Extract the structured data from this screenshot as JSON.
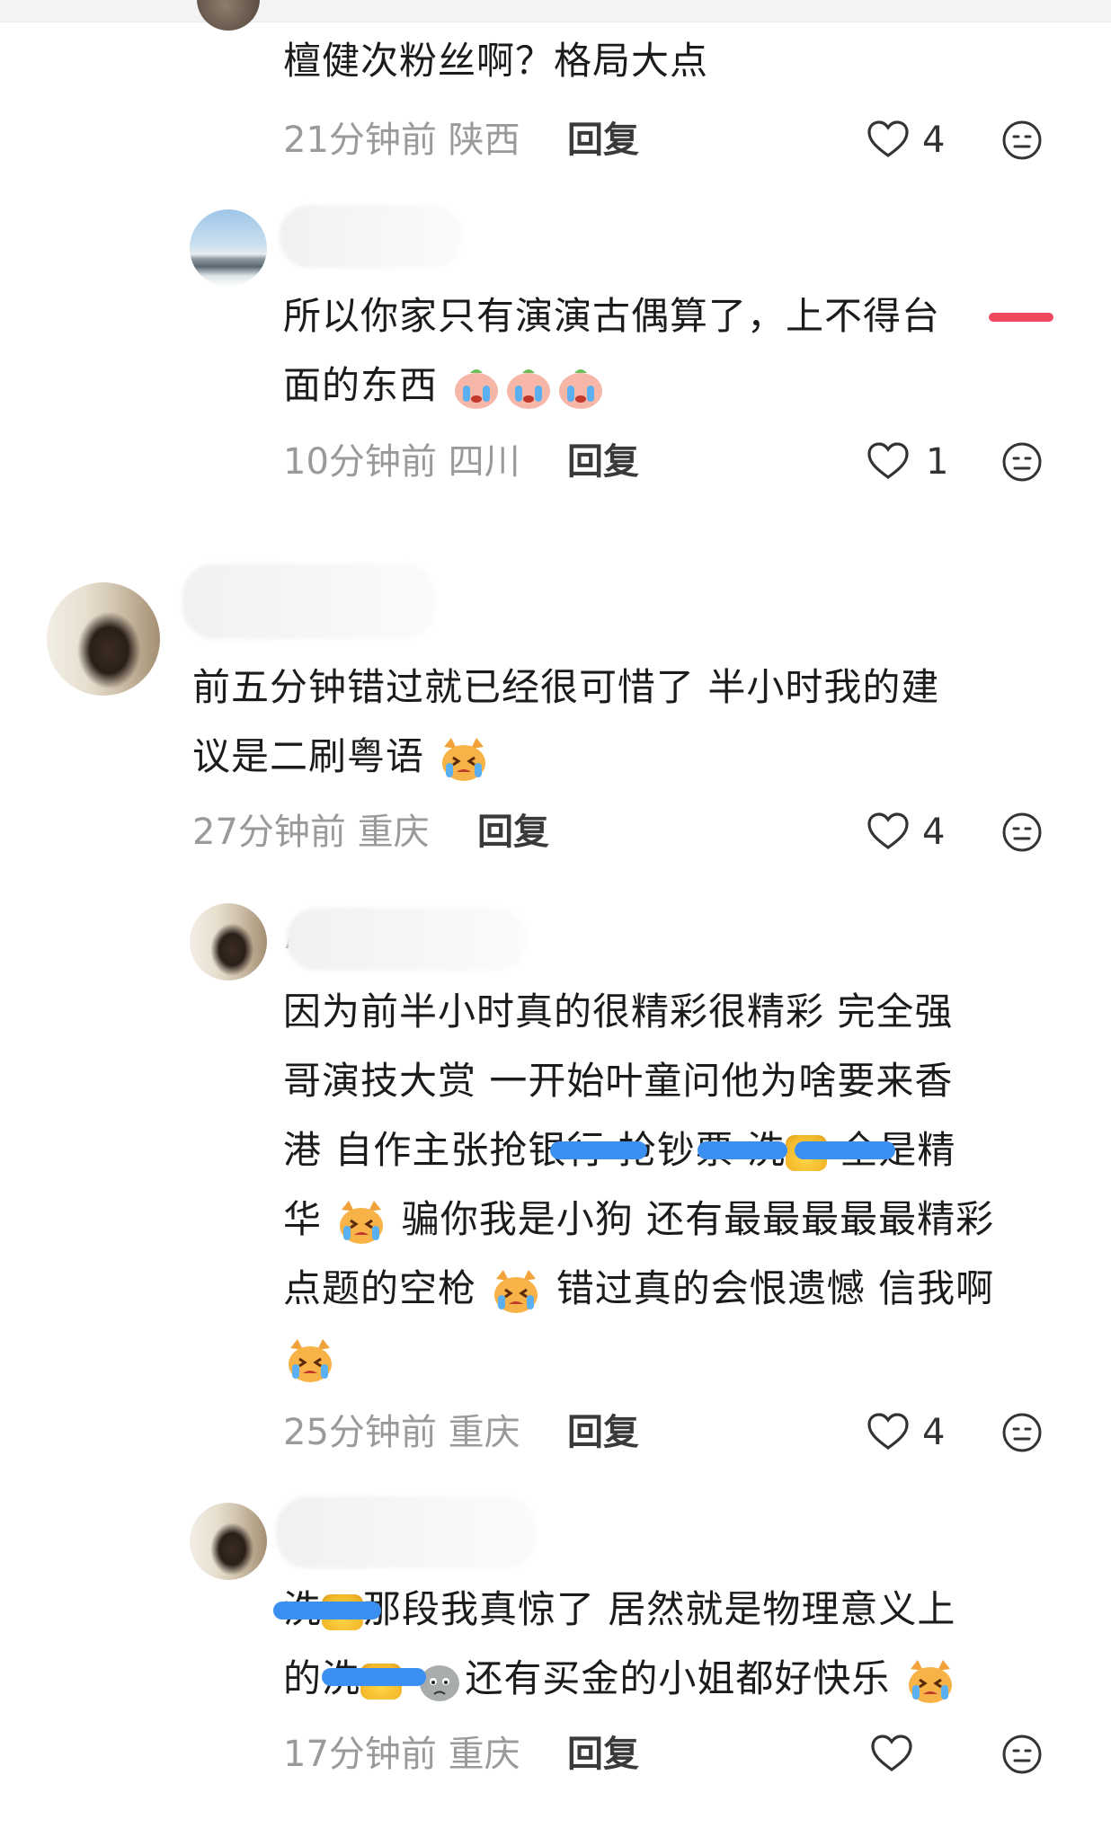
{
  "comments": [
    {
      "text_lines": [
        "檀健次粉丝啊？格局大点"
      ],
      "time": "21分钟前",
      "location": "陕西",
      "reply_label": "回复",
      "likes": "4"
    },
    {
      "text_lines": [
        "所以你家只有演演古偶算了，上不得台",
        "面的东西"
      ],
      "time": "10分钟前",
      "location": "四川",
      "reply_label": "回复",
      "likes": "1"
    },
    {
      "text_lines": [
        "前五分钟错过就已经很可惜了 半小时我的建",
        "议是二刷粤语"
      ],
      "time": "27分钟前",
      "location": "重庆",
      "reply_label": "回复",
      "likes": "4"
    },
    {
      "text_lines": [
        "因为前半小时真的很精彩很精彩 完全强",
        "哥演技大赏 一开始叶童问他为啥要来香",
        "港 自作主张抢银行 抢钞票 洗",
        "华",
        "点题的空枪",
        "错过真的会恨遗憾 信我啊"
      ],
      "line3_end": "全是精",
      "line4_rest": "骗你我是小狗 还有最最最最最精彩",
      "time": "25分钟前",
      "location": "重庆",
      "reply_label": "回复",
      "likes": "4",
      "name_fragment": "/"
    },
    {
      "text_lines": [
        "洗",
        "那段我真惊了 居然就是物理意义上",
        "的洗",
        "还有买金的小姐都好快乐"
      ],
      "time": "17分钟前",
      "location": "重庆",
      "reply_label": "回复",
      "likes": ""
    }
  ],
  "icons": {
    "like": "heart-outline-icon",
    "more": "emoji-face-icon"
  }
}
